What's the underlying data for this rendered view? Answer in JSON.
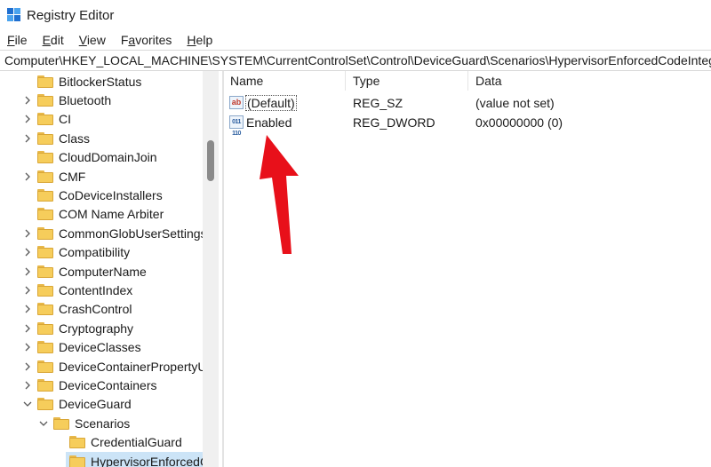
{
  "window": {
    "title": "Registry Editor"
  },
  "menu": [
    {
      "label": "File",
      "accel": "F",
      "rest": "ile"
    },
    {
      "label": "Edit",
      "accel": "E",
      "rest": "dit"
    },
    {
      "label": "View",
      "accel": "V",
      "rest": "iew"
    },
    {
      "label": "Favorites",
      "accel": "a",
      "pre": "F",
      "rest": "vorites"
    },
    {
      "label": "Help",
      "accel": "H",
      "rest": "elp"
    }
  ],
  "address": "Computer\\HKEY_LOCAL_MACHINE\\SYSTEM\\CurrentControlSet\\Control\\DeviceGuard\\Scenarios\\HypervisorEnforcedCodeIntegrity",
  "tree": {
    "items": [
      {
        "label": "BitlockerStatus",
        "level": 1,
        "expander": "none"
      },
      {
        "label": "Bluetooth",
        "level": 1,
        "expander": "collapsed"
      },
      {
        "label": "CI",
        "level": 1,
        "expander": "collapsed"
      },
      {
        "label": "Class",
        "level": 1,
        "expander": "collapsed"
      },
      {
        "label": "CloudDomainJoin",
        "level": 1,
        "expander": "none"
      },
      {
        "label": "CMF",
        "level": 1,
        "expander": "collapsed"
      },
      {
        "label": "CoDeviceInstallers",
        "level": 1,
        "expander": "none"
      },
      {
        "label": "COM Name Arbiter",
        "level": 1,
        "expander": "none"
      },
      {
        "label": "CommonGlobUserSettings",
        "level": 1,
        "expander": "collapsed"
      },
      {
        "label": "Compatibility",
        "level": 1,
        "expander": "collapsed"
      },
      {
        "label": "ComputerName",
        "level": 1,
        "expander": "collapsed"
      },
      {
        "label": "ContentIndex",
        "level": 1,
        "expander": "collapsed"
      },
      {
        "label": "CrashControl",
        "level": 1,
        "expander": "collapsed"
      },
      {
        "label": "Cryptography",
        "level": 1,
        "expander": "collapsed"
      },
      {
        "label": "DeviceClasses",
        "level": 1,
        "expander": "collapsed"
      },
      {
        "label": "DeviceContainerPropertyUp",
        "level": 1,
        "expander": "collapsed"
      },
      {
        "label": "DeviceContainers",
        "level": 1,
        "expander": "collapsed"
      },
      {
        "label": "DeviceGuard",
        "level": 1,
        "expander": "expanded"
      },
      {
        "label": "Scenarios",
        "level": 2,
        "expander": "expanded"
      },
      {
        "label": "CredentialGuard",
        "level": 3,
        "expander": "none"
      },
      {
        "label": "HypervisorEnforcedC",
        "level": 3,
        "expander": "none",
        "selected": true
      }
    ]
  },
  "list": {
    "columns": [
      "Name",
      "Type",
      "Data"
    ],
    "rows": [
      {
        "name": "(Default)",
        "type": "REG_SZ",
        "data": "(value not set)",
        "icon": "string-value-icon",
        "glyph": "ab"
      },
      {
        "name": "Enabled",
        "type": "REG_DWORD",
        "data": "0x00000000 (0)",
        "icon": "binary-value-icon",
        "glyph": "011 110"
      }
    ]
  },
  "colors": {
    "folder": "#f6cd5b",
    "selection": "#cce4f7",
    "arrow": "#e8101a"
  }
}
